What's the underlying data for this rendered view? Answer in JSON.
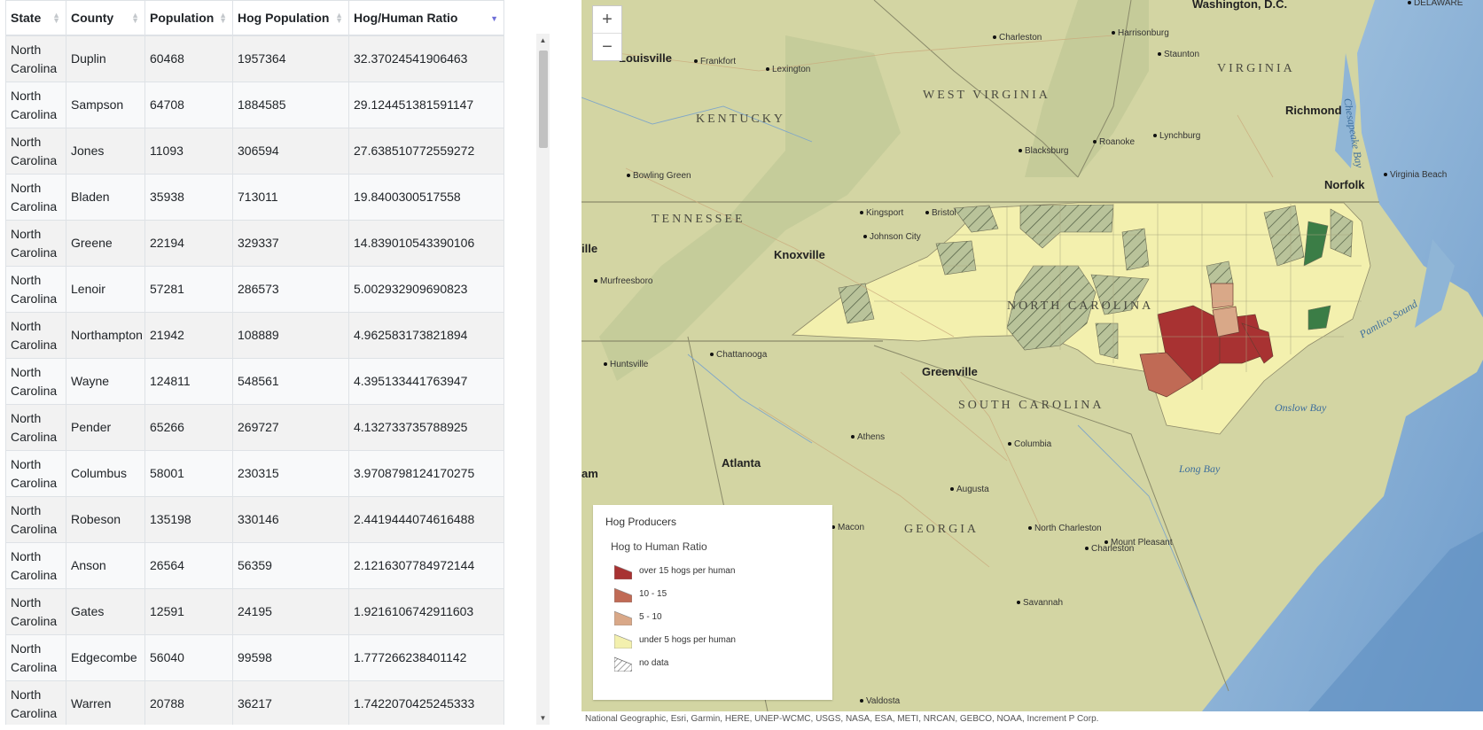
{
  "table": {
    "headers": [
      "State",
      "County",
      "Population",
      "Hog Population",
      "Hog/Human Ratio"
    ],
    "rows": [
      [
        "North Carolina",
        "Duplin",
        "60468",
        "1957364",
        "32.37024541906463"
      ],
      [
        "North Carolina",
        "Sampson",
        "64708",
        "1884585",
        "29.124451381591147"
      ],
      [
        "North Carolina",
        "Jones",
        "11093",
        "306594",
        "27.638510772559272"
      ],
      [
        "North Carolina",
        "Bladen",
        "35938",
        "713011",
        "19.8400300517558"
      ],
      [
        "North Carolina",
        "Greene",
        "22194",
        "329337",
        "14.839010543390106"
      ],
      [
        "North Carolina",
        "Lenoir",
        "57281",
        "286573",
        "5.002932909690823"
      ],
      [
        "North Carolina",
        "Northampton",
        "21942",
        "108889",
        "4.962583173821894"
      ],
      [
        "North Carolina",
        "Wayne",
        "124811",
        "548561",
        "4.395133441763947"
      ],
      [
        "North Carolina",
        "Pender",
        "65266",
        "269727",
        "4.132733735788925"
      ],
      [
        "North Carolina",
        "Columbus",
        "58001",
        "230315",
        "3.9708798124170275"
      ],
      [
        "North Carolina",
        "Robeson",
        "135198",
        "330146",
        "2.4419444074616488"
      ],
      [
        "North Carolina",
        "Anson",
        "26564",
        "56359",
        "2.1216307784972144"
      ],
      [
        "North Carolina",
        "Gates",
        "12591",
        "24195",
        "1.9216106742911603"
      ],
      [
        "North Carolina",
        "Edgecombe",
        "56040",
        "99598",
        "1.777266238401142"
      ],
      [
        "North Carolina",
        "Warren",
        "20788",
        "36217",
        "1.7422070425245333"
      ]
    ]
  },
  "map": {
    "zoom_in": "+",
    "zoom_out": "−",
    "places": [
      "Washington, D.C.",
      "DELAWARE",
      "Louisville",
      "Frankfort",
      "Lexington",
      "Charleston",
      "Harrisonburg",
      "Staunton",
      "VIRGINIA",
      "WEST VIRGINIA",
      "KENTUCKY",
      "Richmond",
      "Lynchburg",
      "Roanoke",
      "Blacksburg",
      "Bowling Green",
      "Virginia Beach",
      "Norfolk",
      "TENNESSEE",
      "Kingsport",
      "Bristol",
      "Johnson City",
      "Knoxville",
      "Murfreesboro",
      "Huntsville",
      "Chattanooga",
      "Greenville",
      "SOUTH CAROLINA",
      "Athens",
      "Columbia",
      "Atlanta",
      "Augusta",
      "GEORGIA",
      "Macon",
      "North Charleston",
      "Mount Pleasant",
      "Charleston",
      "Savannah",
      "Valdosta",
      "Onslow Bay",
      "Long Bay",
      "Pamlico Sound",
      "Chesapeake Bay",
      "NORTH CAROLINA",
      "ille",
      "am"
    ],
    "attribution": "National Geographic, Esri, Garmin, HERE, UNEP-WCMC, USGS, NASA, ESA, METI, NRCAN, GEBCO, NOAA, Increment P Corp."
  },
  "legend": {
    "title": "Hog Producers",
    "subtitle": "Hog to Human Ratio",
    "items": [
      {
        "label": "over 15 hogs per human",
        "color": "#a83232"
      },
      {
        "label": "10 - 15",
        "color": "#c06a55"
      },
      {
        "label": "5 - 10",
        "color": "#d9a888"
      },
      {
        "label": "under 5 hogs per human",
        "color": "#f3f0ae"
      },
      {
        "label": "no data",
        "color": "hatch"
      }
    ]
  },
  "colors": {
    "ocean": "#8fb5d6",
    "land": "#d4d6a5",
    "accent": "#6f6fd8"
  }
}
